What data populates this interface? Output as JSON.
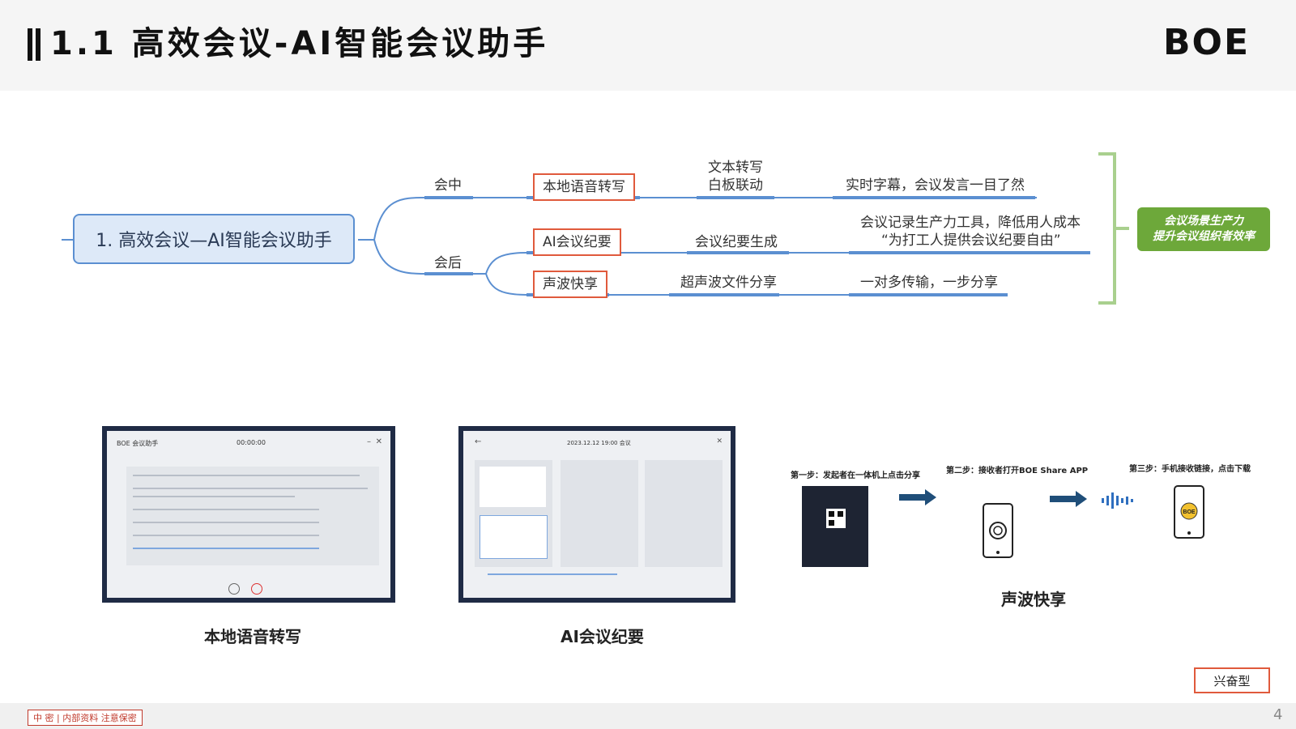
{
  "header": {
    "title": "1.1 高效会议-AI智能会议助手",
    "logo": "BOE"
  },
  "mindmap": {
    "root": "1. 高效会议—AI智能会议助手",
    "branches": {
      "during": "会中",
      "after": "会后"
    },
    "features": [
      {
        "name": "本地语音转写",
        "function_lines": [
          "文本转写",
          "白板联动"
        ],
        "benefit_lines": [
          "实时字幕，会议发言一目了然"
        ]
      },
      {
        "name": "AI会议纪要",
        "function_lines": [
          "会议纪要生成"
        ],
        "benefit_lines": [
          "会议记录生产力工具，降低用人成本",
          "“为打工人提供会议纪要自由”"
        ]
      },
      {
        "name": "声波快享",
        "function_lines": [
          "超声波文件分享"
        ],
        "benefit_lines": [
          "一对多传输，一步分享"
        ]
      }
    ],
    "summary_lines": [
      "会议场景生产力",
      "提升会议组织者效率"
    ]
  },
  "screenshots": {
    "transcribe": {
      "app_title": "BOE 会议助手",
      "timer": "00:00:00",
      "caption": "本地语音转写"
    },
    "minutes": {
      "header_time": "2023.12.12 19:00 会议",
      "caption": "AI会议纪要"
    },
    "share": {
      "steps": [
        "第一步：发起者在一体机上点击分享",
        "第二步：接收者打开BOE Share APP",
        "第三步：手机接收链接，点击下载"
      ],
      "caption": "声波快享"
    }
  },
  "tag": "兴奋型",
  "footer": {
    "classification": "中 密 | 内部资料 注意保密",
    "page_number": "4"
  },
  "colors": {
    "accent_red": "#e05a3c",
    "line_blue": "#5b8fd1",
    "summary_green": "#6da83a",
    "bracket_green": "#a9d08e"
  }
}
